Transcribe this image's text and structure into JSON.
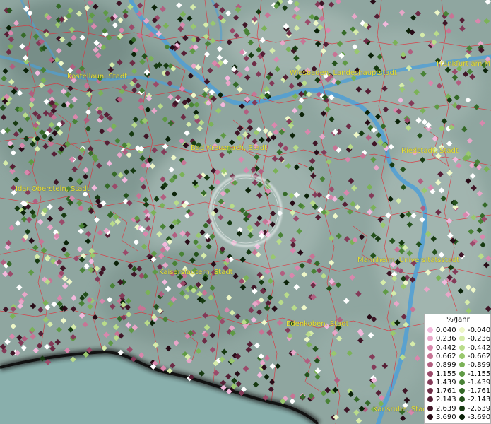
{
  "map": {
    "colors": {
      "water": "#4f9fd6",
      "border": "#e0303a",
      "terrain": "#8fa6a0",
      "coast": "#1a1a1a"
    }
  },
  "cities": [
    {
      "id": "kastellaun",
      "label": "Kastellaun, Stadt"
    },
    {
      "id": "wiesbaden",
      "label": "Wiesbaden, Landeshauptstadt"
    },
    {
      "id": "frankfurt",
      "label": "Frankfurt am M"
    },
    {
      "id": "badkreuznach",
      "label": "Bad Kreuznach, Stadt"
    },
    {
      "id": "riedstadt",
      "label": "Riedstadt, Stadt"
    },
    {
      "id": "idaroberstein",
      "label": "Idar-Oberstein, Stadt"
    },
    {
      "id": "kaiserslautern",
      "label": "Kaiserslautern, Stadt"
    },
    {
      "id": "mannheim",
      "label": "Mannheim, Universitätsstadt"
    },
    {
      "id": "edenkoben",
      "label": "Edenkoben, Stadt"
    },
    {
      "id": "karlsruhe",
      "label": "Karlsruhe, Stad"
    }
  ],
  "legend": {
    "title": "%/Jahr",
    "positive": [
      {
        "value": "0.040",
        "color": "#f2b8dc"
      },
      {
        "value": "0.236",
        "color": "#e8a6c8"
      },
      {
        "value": "0.442",
        "color": "#d987ad"
      },
      {
        "value": "0.662",
        "color": "#c87495"
      },
      {
        "value": "0.899",
        "color": "#b25e80"
      },
      {
        "value": "1.155",
        "color": "#9b4a6a"
      },
      {
        "value": "1.439",
        "color": "#843a58"
      },
      {
        "value": "1.761",
        "color": "#6d2b45"
      },
      {
        "value": "2.143",
        "color": "#561f35"
      },
      {
        "value": "2.639",
        "color": "#3f1526"
      },
      {
        "value": "3.690",
        "color": "#280c17"
      }
    ],
    "negative": [
      {
        "value": "-0.040",
        "color": "#eef7c8"
      },
      {
        "value": "-0.236",
        "color": "#d6ecaa"
      },
      {
        "value": "-0.442",
        "color": "#b9dc8a"
      },
      {
        "value": "-0.662",
        "color": "#99c86e"
      },
      {
        "value": "-0.899",
        "color": "#7bb257"
      },
      {
        "value": "-1.155",
        "color": "#5f9a45"
      },
      {
        "value": "-1.439",
        "color": "#498236"
      },
      {
        "value": "-1.761",
        "color": "#356a28"
      },
      {
        "value": "-2.143",
        "color": "#25521c"
      },
      {
        "value": "-2.639",
        "color": "#173a11"
      },
      {
        "value": "-3.690",
        "color": "#0b2208"
      }
    ]
  }
}
